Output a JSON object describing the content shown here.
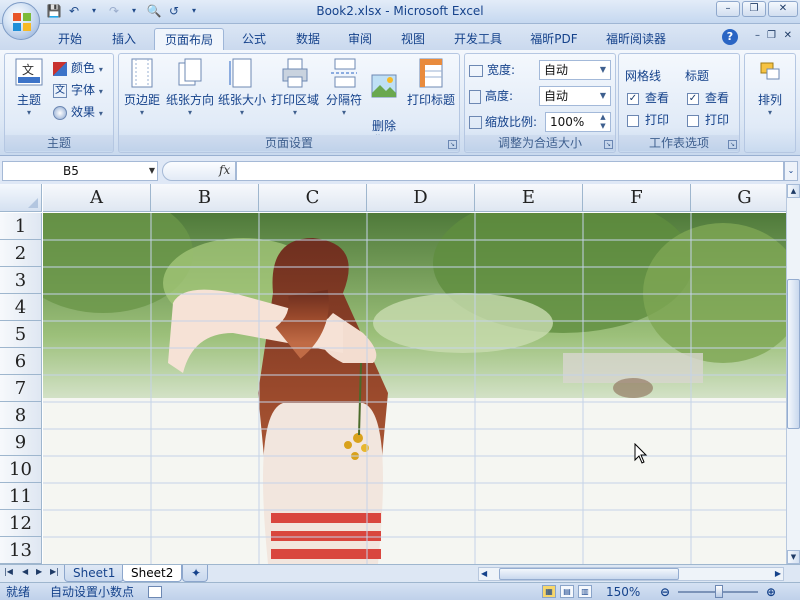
{
  "window": {
    "title": "Book2.xlsx - Microsoft Excel",
    "controls": [
      "–",
      "❐",
      "✕"
    ]
  },
  "qat": [
    "save",
    "undo",
    "redo",
    "print-preview",
    "customize"
  ],
  "tabs": [
    "开始",
    "插入",
    "页面布局",
    "公式",
    "数据",
    "审阅",
    "视图",
    "开发工具",
    "福昕PDF",
    "福昕阅读器"
  ],
  "active_tab": "页面布局",
  "ribbon": {
    "themes": {
      "title": "主题",
      "theme_button": "主题",
      "colors": "颜色",
      "fonts": "字体",
      "effects": "效果"
    },
    "page_setup": {
      "title": "页面设置",
      "margins": "页边距",
      "orientation": "纸张方向",
      "size": "纸张大小",
      "print_area": "打印区域",
      "breaks": "分隔符",
      "background": "删除\n背景",
      "print_titles": "打印标题"
    },
    "scale_to_fit": {
      "title": "调整为合适大小",
      "width_label": "宽度:",
      "width_value": "自动",
      "height_label": "高度:",
      "height_value": "自动",
      "scale_label": "缩放比例:",
      "scale_value": "100%"
    },
    "sheet_options": {
      "title": "工作表选项",
      "gridlines": "网格线",
      "headings": "标题",
      "view": "查看",
      "print": "打印",
      "gridlines_view_checked": true,
      "gridlines_print_checked": false,
      "headings_view_checked": true,
      "headings_print_checked": false
    },
    "arrange": {
      "button": "排列"
    }
  },
  "formula_bar": {
    "name_box": "B5",
    "fx": "fx",
    "content": ""
  },
  "columns": [
    "A",
    "B",
    "C",
    "D",
    "E",
    "F",
    "G"
  ],
  "rows": [
    "1",
    "2",
    "3",
    "4",
    "5",
    "6",
    "7",
    "8",
    "9",
    "10",
    "11",
    "12",
    "13"
  ],
  "sheets": [
    "Sheet1",
    "Sheet2"
  ],
  "active_sheet": "Sheet2",
  "status": {
    "ready": "就绪",
    "auto_decimal": "自动设置小数点",
    "zoom": "150%"
  },
  "colors": {
    "accent": "#15428b",
    "ribbon_bg": "#dce7f5",
    "gridline": "#c5d3e8"
  }
}
